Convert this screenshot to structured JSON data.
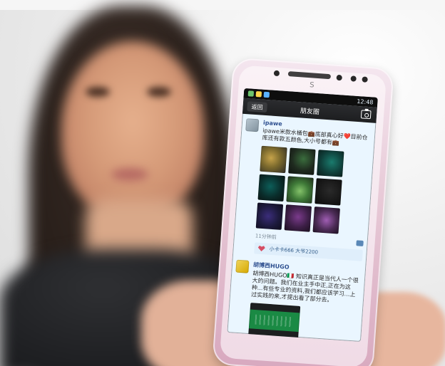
{
  "statusbar": {
    "time": "12:48"
  },
  "app": {
    "back_label": "返回",
    "title": "朋友圈"
  },
  "posts": [
    {
      "username": "ipawe",
      "text": "ipawe米款水桶包💼底部真心好❤️目前仓库还有款五颜色,大小号都有💼",
      "meta_left": "11分钟前",
      "likes_text": "小卡卡666 大爷2200"
    },
    {
      "username": "胡博西HUGO",
      "text": "胡博西HUGO🇮🇹 知识真正是当代人一个很大的问题。我们在业主手中正,正在为这种...有些专业的资料,我们都应该学习...上过实践的来,才提出看了部分去。",
      "meta_left": ""
    }
  ],
  "icons": [
    "camera-icon",
    "comment-icon",
    "heart-icon"
  ]
}
